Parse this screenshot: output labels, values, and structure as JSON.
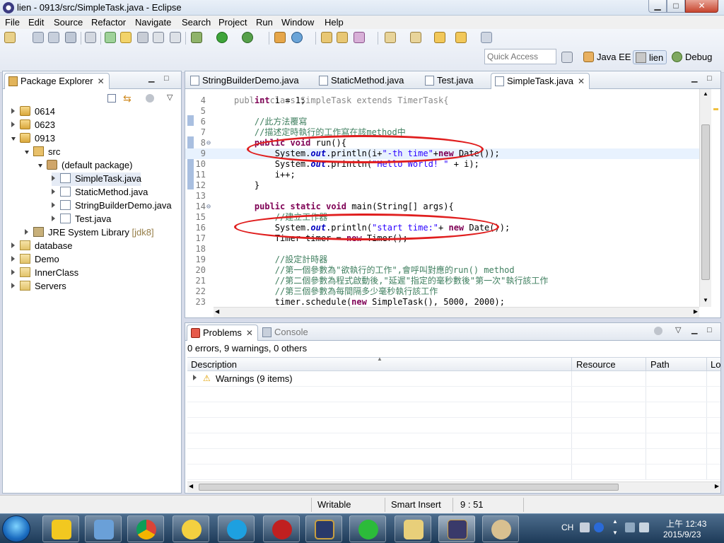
{
  "window": {
    "title": "lien - 0913/src/SimpleTask.java - Eclipse",
    "min": "▁",
    "max": "□",
    "close": "✕"
  },
  "menu": [
    "File",
    "Edit",
    "Source",
    "Refactor",
    "Navigate",
    "Search",
    "Project",
    "Run",
    "Window",
    "Help"
  ],
  "toolbar": {
    "quick_access_placeholder": "Quick Access",
    "perspectives": [
      "Java EE",
      "lien",
      "Debug"
    ]
  },
  "package_explorer": {
    "title": "Package Explorer",
    "items": [
      {
        "label": "0614"
      },
      {
        "label": "0623"
      },
      {
        "label": "0913"
      },
      {
        "label": "src"
      },
      {
        "label": "(default package)"
      },
      {
        "label": "SimpleTask.java"
      },
      {
        "label": "StaticMethod.java"
      },
      {
        "label": "StringBuilderDemo.java"
      },
      {
        "label": "Test.java"
      },
      {
        "label": "JRE System Library",
        "suffix": "[jdk8]"
      },
      {
        "label": "database"
      },
      {
        "label": "Demo"
      },
      {
        "label": "InnerClass"
      },
      {
        "label": "Servers"
      }
    ]
  },
  "editor": {
    "tabs": [
      "StringBuilderDemo.java",
      "StaticMethod.java",
      "Test.java",
      "SimpleTask.java"
    ],
    "active_tab": "SimpleTask.java",
    "top_partial": "public class SimpleTask extends TimerTask{",
    "lines": [
      {
        "n": "4",
        "code": "    int i = 1;"
      },
      {
        "n": "5",
        "code": ""
      },
      {
        "n": "6",
        "code": "    //此方法覆寫"
      },
      {
        "n": "7",
        "code": "    //描述定時執行的工作寫在該method中"
      },
      {
        "n": "8",
        "code": "    public void run(){"
      },
      {
        "n": "9",
        "code": "        System.out.println(i+\"-th time\"+new Date());"
      },
      {
        "n": "10",
        "code": "        System.out.println(\"Hello World! \" + i);"
      },
      {
        "n": "11",
        "code": "        i++;"
      },
      {
        "n": "12",
        "code": "    }"
      },
      {
        "n": "13",
        "code": ""
      },
      {
        "n": "14",
        "code": "    public static void main(String[] args){"
      },
      {
        "n": "15",
        "code": "        //建立工作器"
      },
      {
        "n": "16",
        "code": "        System.out.println(\"start time:\"+ new Date());"
      },
      {
        "n": "17",
        "code": "        Timer timer = new Timer();"
      },
      {
        "n": "18",
        "code": ""
      },
      {
        "n": "19",
        "code": "        //設定計時器"
      },
      {
        "n": "20",
        "code": "        //第一個參數為\"欲執行的工作\",會呼叫對應的run() method"
      },
      {
        "n": "21",
        "code": "        //第二個參數為程式啟動後,\"延遲\"指定的毫秒數後\"第一次\"執行該工作"
      },
      {
        "n": "22",
        "code": "        //第三個參數為每間隔多少毫秒執行該工作"
      },
      {
        "n": "23",
        "code": "        timer.schedule(new SimpleTask(), 5000, 2000);"
      }
    ]
  },
  "problems": {
    "tabs": [
      "Problems",
      "Console"
    ],
    "summary": "0 errors, 9 warnings, 0 others",
    "columns": [
      "Description",
      "Resource",
      "Path",
      "Lo"
    ],
    "rows": [
      {
        "description": "Warnings (9 items)"
      }
    ]
  },
  "status": {
    "writable": "Writable",
    "insert_mode": "Smart Insert",
    "position": "9 : 51"
  },
  "tray": {
    "lang": "CH",
    "time": "上午 12:43",
    "date": "2015/9/23"
  },
  "colors": {
    "annotation_ellipse": "#e01e1e",
    "keyword": "#7f0055",
    "string": "#2a00ff",
    "comment": "#3f7f5f"
  }
}
